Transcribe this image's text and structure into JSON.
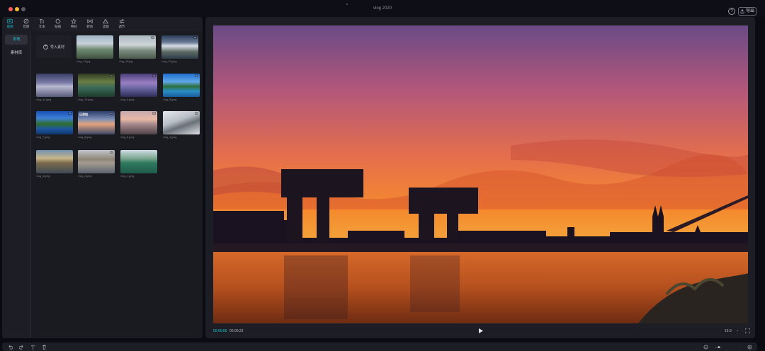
{
  "window": {
    "title": "vlog 2020",
    "help_label": "?",
    "export_label": "导出"
  },
  "tabs": [
    {
      "label": "视频",
      "icon": "video-icon",
      "active": true
    },
    {
      "label": "音频",
      "icon": "audio-icon",
      "active": false
    },
    {
      "label": "文本",
      "icon": "text-icon",
      "active": false
    },
    {
      "label": "贴纸",
      "icon": "sticker-icon",
      "active": false
    },
    {
      "label": "特效",
      "icon": "effects-icon",
      "active": false
    },
    {
      "label": "转场",
      "icon": "transition-icon",
      "active": false
    },
    {
      "label": "滤镜",
      "icon": "filter-icon",
      "active": false
    },
    {
      "label": "调节",
      "icon": "adjust-icon",
      "active": false
    }
  ],
  "sidebar": {
    "items": [
      {
        "label": "本地",
        "active": true
      },
      {
        "label": "素材库",
        "active": false
      }
    ]
  },
  "media": {
    "import_label": "导入素材",
    "items": [
      {
        "name": "vlog_14.jpg",
        "badge": "",
        "tag": ""
      },
      {
        "name": "vlog_13.jpg",
        "badge": "",
        "tag": ""
      },
      {
        "name": "vlog_12.jpeg",
        "badge": "",
        "tag": ""
      },
      {
        "name": "vlog_11.jpeg",
        "badge": "",
        "tag": ""
      },
      {
        "name": "vlog_10.jpeg",
        "badge": "",
        "tag": ""
      },
      {
        "name": "vlog_9.jpeg",
        "badge": "",
        "tag": ""
      },
      {
        "name": "vlog_8.jpeg",
        "badge": "",
        "tag": ""
      },
      {
        "name": "vlog_7.jpeg",
        "badge": "",
        "tag": ""
      },
      {
        "name": "vlog_6.jpeg",
        "badge": "",
        "tag": "已添加"
      },
      {
        "name": "vlog_5.jpeg",
        "badge": "",
        "tag": ""
      },
      {
        "name": "vlog_4.jpeg",
        "badge": "",
        "tag": ""
      },
      {
        "name": "vlog_3.jpeg",
        "badge": "",
        "tag": ""
      },
      {
        "name": "vlog_2.jpeg",
        "badge": "",
        "tag": ""
      },
      {
        "name": "vlog_1.jpeg",
        "badge": "",
        "tag": ""
      }
    ]
  },
  "player": {
    "current_time": "00:00:00",
    "total_time": "00:00:23",
    "aspect_ratio": "16:9",
    "accent_color": "#18c6d6"
  }
}
